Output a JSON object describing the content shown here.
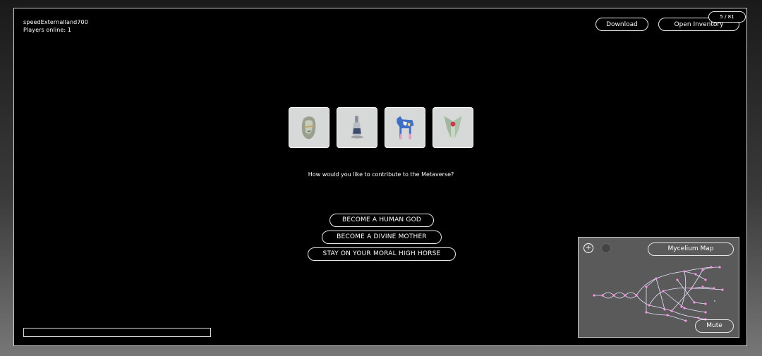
{
  "user": {
    "name": "speedExternalland700",
    "players_online": "Players online: 1"
  },
  "header": {
    "download_label": "Download",
    "inventory_label": "Open Inventory",
    "counter": "5 / 81"
  },
  "tiles": [
    {
      "icon": "rock-statue-icon"
    },
    {
      "icon": "bottle-icon"
    },
    {
      "icon": "horse-statue-icon"
    },
    {
      "icon": "winged-figure-icon"
    }
  ],
  "question": "How would you like to contribute to the Metaverse?",
  "choices": [
    "BECOME A HUMAN GOD",
    "BECOME A DIVINE MOTHER",
    "STAY ON YOUR MORAL HIGH HORSE"
  ],
  "progress": 0,
  "map": {
    "title": "Mycelium Map",
    "zoom_in_label": "+",
    "mute_label": "Mute",
    "colors": {
      "node": "#ff8fe8",
      "edge": "#e6e6ff",
      "panel": "#5a5a5a"
    }
  }
}
